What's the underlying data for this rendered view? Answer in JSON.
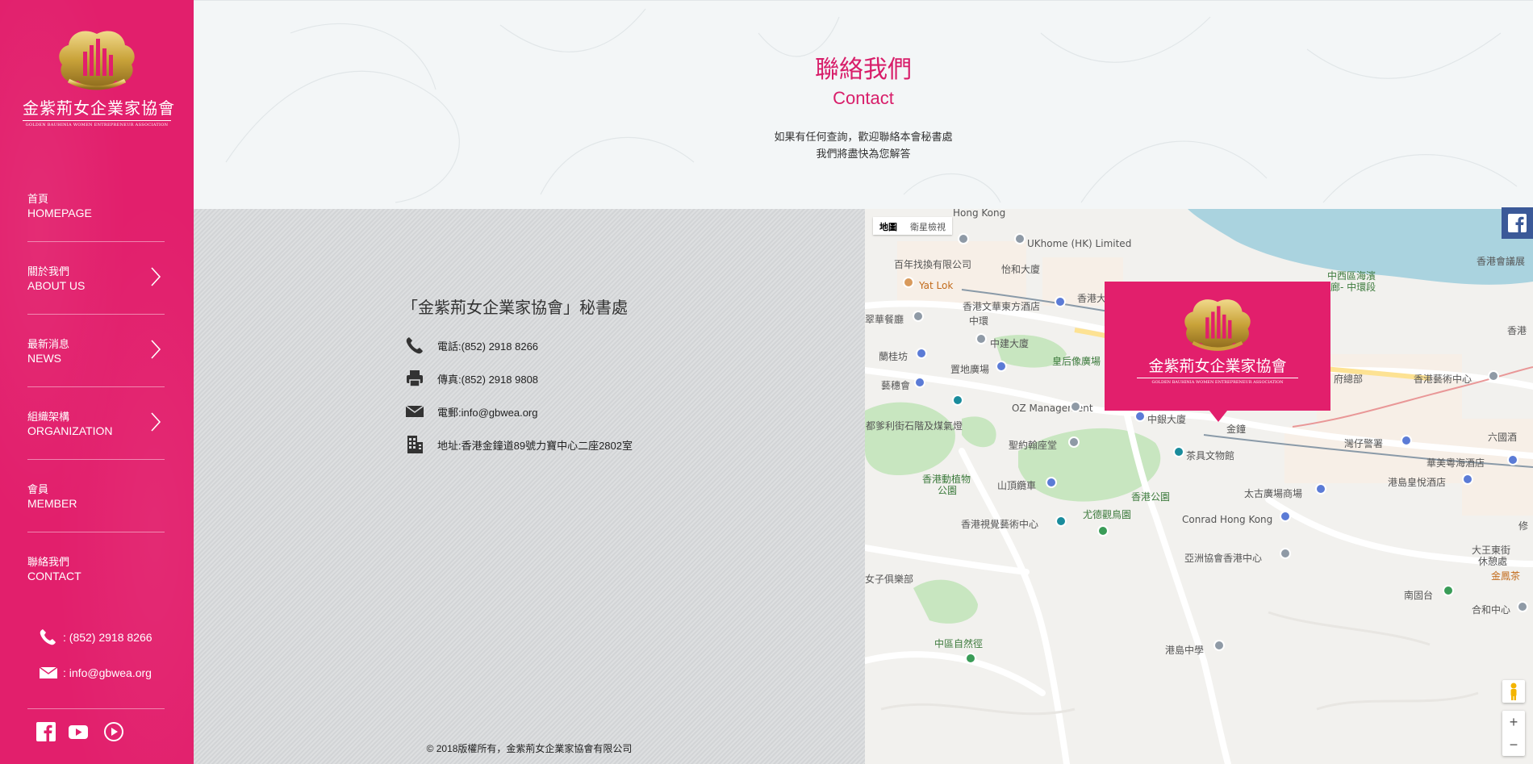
{
  "sidebar": {
    "logo_cn": "金紫荊女企業家協會",
    "logo_en": "GOLDEN BAUHINIA WOMEN ENTREPRENEUR ASSOCIATION",
    "nav": [
      {
        "cn": "首頁",
        "en": "HOMEPAGE",
        "has_submenu": false
      },
      {
        "cn": "關於我們",
        "en": "ABOUT US",
        "has_submenu": true
      },
      {
        "cn": "最新消息",
        "en": "NEWS",
        "has_submenu": true
      },
      {
        "cn": "組織架構",
        "en": "ORGANIZATION",
        "has_submenu": true
      },
      {
        "cn": "會員",
        "en": "MEMBER",
        "has_submenu": false
      },
      {
        "cn": "聯絡我們",
        "en": "CONTACT",
        "has_submenu": false
      }
    ],
    "phone": ": (852) 2918 8266",
    "email": ": info@gbwea.org",
    "social": [
      "facebook-icon",
      "youtube-icon",
      "play-icon"
    ]
  },
  "header": {
    "title_cn": "聯絡我們",
    "title_en": "Contact",
    "intro_line1": "如果有任何查詢，歡迎聯絡本會秘書處",
    "intro_line2": "我們將盡快為您解答"
  },
  "contact": {
    "office_title": "「金紫荊女企業家協會」秘書處",
    "phone": "電話:(852) 2918 8266",
    "fax": "傳真:(852) 2918 9808",
    "email": "電郵:info@gbwea.org",
    "address": "地址:香港金鐘道89號力寶中心二座2802室"
  },
  "footer": {
    "copyright": "© 2018版權所有，金紫荊女企業家協會有限公司"
  },
  "map": {
    "type_map": "地圖",
    "type_satellite": "衛星檢視",
    "popup_cn": "金紫荊女企業家協會",
    "popup_en": "GOLDEN BAUHINIA WOMEN ENTREPRENEUR ASSOCIATION",
    "zoom_in": "+",
    "zoom_out": "−",
    "labels": {
      "hongkong": "Hong Kong",
      "ukhome": "UKhome (HK) Limited",
      "baiwan": "百年找換有限公司",
      "yihe": "怡和大廈",
      "yatlok": "Yat Lok",
      "mandarin": "香港文華東方酒店",
      "xianggang": "香港大",
      "cuihua": "翠華餐廳",
      "central": "中環",
      "cheung": "中建大廈",
      "lankwai": "蘭桂坊",
      "statue": "皇后像廣場",
      "yisui": "藝穗會",
      "landmark": "置地廣場",
      "ozm": "OZ Management",
      "boc": "中銀大廈",
      "admiralty": "金鐘",
      "duddell": "都爹利街石階及煤氣燈",
      "stjohn": "聖約翰座堂",
      "teaware": "茶具文物館",
      "zoo": "香港動植物",
      "zoo2": "公園",
      "peaktram": "山頂纜車",
      "hkpark": "香港公園",
      "aviary": "尤德觀鳥園",
      "visualarts": "香港視覺藝術中心",
      "conrad": "Conrad Hong Kong",
      "pacific": "太古廣場商場",
      "asiasoc": "亞洲協會香港中心",
      "club": "女子俱樂部",
      "midlevels": "中區自然徑",
      "island": "港島中學",
      "harbour": "中西區海濱",
      "harbour2": "長廊- 中環段",
      "legco": "香港會議展",
      "arts": "香港藝術中心",
      "govt": "府總部",
      "police": "灣仔警署",
      "hkg": "香港",
      "wanchaihotel": "華美粵海酒店",
      "sixth": "六國酒",
      "regal": "港島皇悅酒店",
      "queen": "大王東街",
      "queen2": "休憩處",
      "nanyan": "南固台",
      "hehe": "合和中心",
      "golden": "金鳳茶",
      "xiu": "修"
    }
  },
  "colors": {
    "brand": "#e21f6c",
    "gold": "#c9a33a"
  }
}
